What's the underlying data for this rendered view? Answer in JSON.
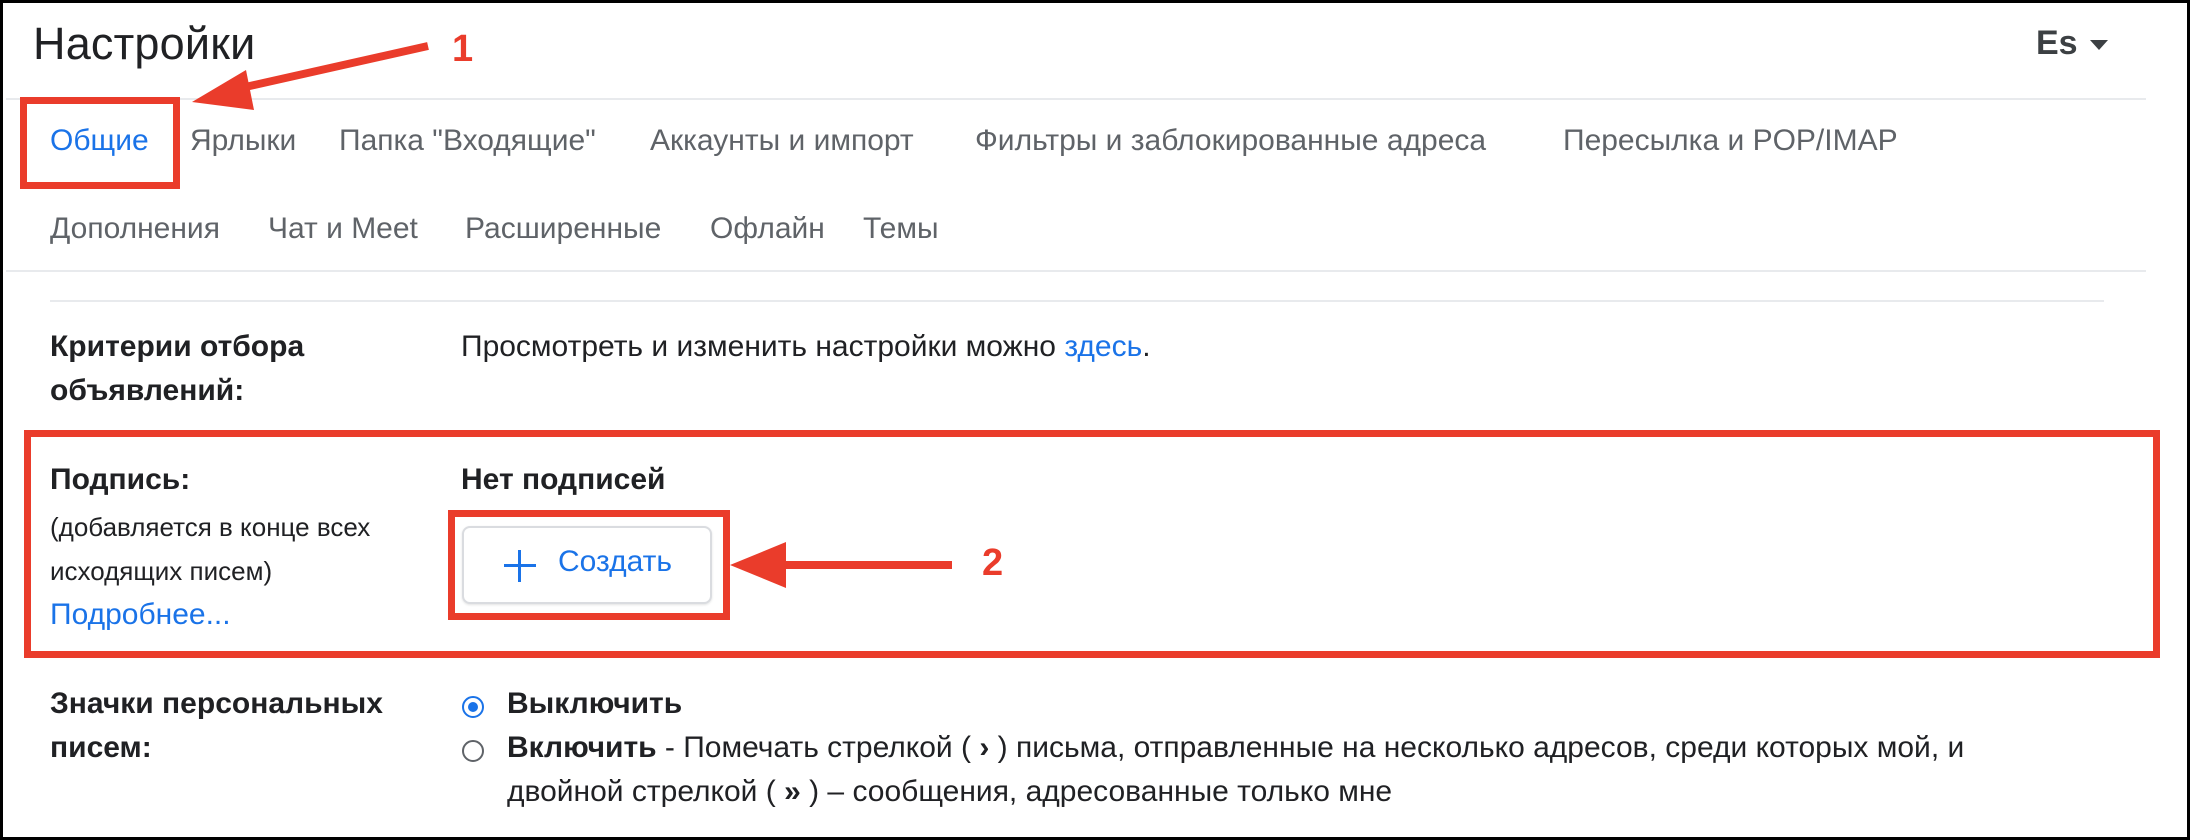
{
  "header": {
    "title": "Настройки",
    "account": "Es"
  },
  "tabs_row1": [
    {
      "label": "Общие",
      "active": true
    },
    {
      "label": "Ярлыки"
    },
    {
      "label": "Папка \"Входящие\""
    },
    {
      "label": "Аккаунты и импорт"
    },
    {
      "label": "Фильтры и заблокированные адреса"
    },
    {
      "label": "Пересылка и POP/IMAP"
    }
  ],
  "tabs_row2": [
    {
      "label": "Дополнения"
    },
    {
      "label": "Чат и Meet"
    },
    {
      "label": "Расширенные"
    },
    {
      "label": "Офлайн"
    },
    {
      "label": "Темы"
    }
  ],
  "ads": {
    "label_line1": "Критерии отбора",
    "label_line2": "объявлений:",
    "text": "Просмотреть и изменить настройки можно ",
    "link": "здесь",
    "period": "."
  },
  "signature": {
    "label": "Подпись:",
    "desc_line1": "(добавляется в конце всех",
    "desc_line2": "исходящих писем)",
    "learn_more": "Подробнее...",
    "status": "Нет подписей",
    "create_button": "Создать"
  },
  "personal": {
    "label_line1": "Значки персональных",
    "label_line2": "писем:",
    "option_off": "Выключить",
    "option_on": "Включить",
    "option_on_desc1": " - Помечать стрелкой ( ",
    "single_arrow": "›",
    "option_on_desc2": " ) письма, отправленные на несколько адресов, среди которых мой, и",
    "option_on_line2a": "двойной стрелкой ( ",
    "double_arrow": "»",
    "option_on_line2b": " ) – сообщения, адресованные только мне",
    "selected": "off"
  },
  "annotations": {
    "marker1": "1",
    "marker2": "2"
  },
  "colors": {
    "accent": "#1a73e8",
    "annotation": "#ea3c2b",
    "text": "#202124",
    "muted": "#5f6368"
  }
}
